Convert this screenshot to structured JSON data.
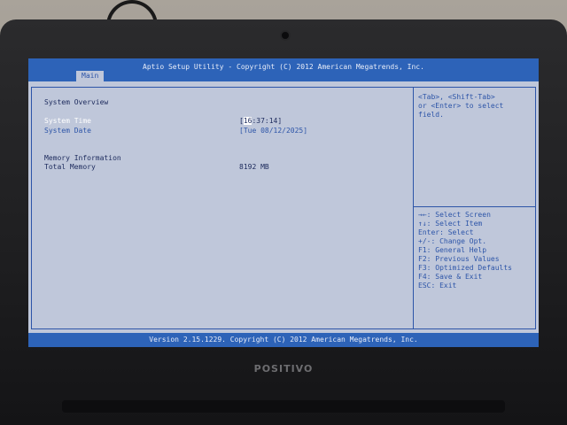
{
  "device": {
    "brand": "POSITIVO"
  },
  "bios": {
    "title": "Aptio Setup Utility - Copyright (C) 2012 American Megatrends, Inc.",
    "tabs": [
      {
        "label": "Main",
        "active": true
      }
    ],
    "main": {
      "overview_label": "System Overview",
      "system_time": {
        "label": "System Time",
        "open": "[",
        "hour": "16",
        "rest": ":37:14]"
      },
      "system_date": {
        "label": "System Date",
        "value": "[Tue 08/12/2025]"
      },
      "memory_info_label": "Memory Information",
      "total_memory": {
        "label": "Total Memory",
        "value": "8192 MB"
      }
    },
    "help_lines": [
      "<Tab>, <Shift-Tab>",
      "or <Enter> to select",
      "field."
    ],
    "key_help": [
      "→←: Select Screen",
      "↑↓: Select Item",
      "Enter: Select",
      "+/-: Change Opt.",
      "F1: General Help",
      "F2: Previous Values",
      "F3: Optimized Defaults",
      "F4: Save & Exit",
      "ESC: Exit"
    ],
    "footer": "Version 2.15.1229. Copyright (C) 2012 American Megatrends, Inc."
  },
  "colors": {
    "bios_blue": "#2d63b8",
    "screen_bg": "#bfc7da",
    "text_dark": "#1c2a5c",
    "highlight": "#ffffff"
  }
}
